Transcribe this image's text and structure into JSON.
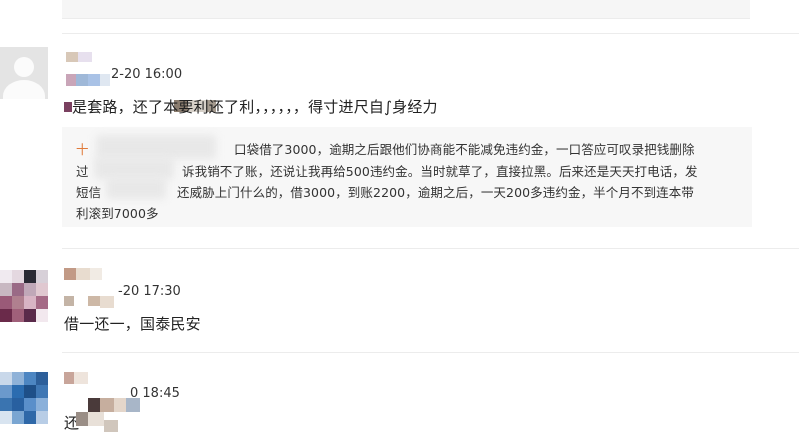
{
  "comments": [
    {
      "time": "2-20 16:00",
      "text": "是套路，还了本要利还了利，，，，，，得寸进尺自∫身经力",
      "reply": {
        "prefix": "十",
        "lines": [
          "口袋借了3000，逾期之后跟他们协商能不能减免违约金，一口答应可叹录把钱删除",
          "诉我销不了账，还说让我再给500违约金。当时就草了，直接拉黑。后来还是天天打电话，发",
          "还威胁上门什么的，借3000，到账2200，逾期之后，一天200多违约金，半个月不到连本带",
          "利滚到7000多"
        ],
        "line_prefixes": [
          "",
          "过",
          "短信",
          ""
        ]
      }
    },
    {
      "time": "-20 17:30",
      "text": "借一还一，国泰民安"
    },
    {
      "time": "0 18:45",
      "text": "还"
    }
  ],
  "colors": {
    "mosaic_purple": "#5a2a4a",
    "mosaic_blue": "#2b6cb0",
    "quote_bg": "#f7f7f7"
  }
}
